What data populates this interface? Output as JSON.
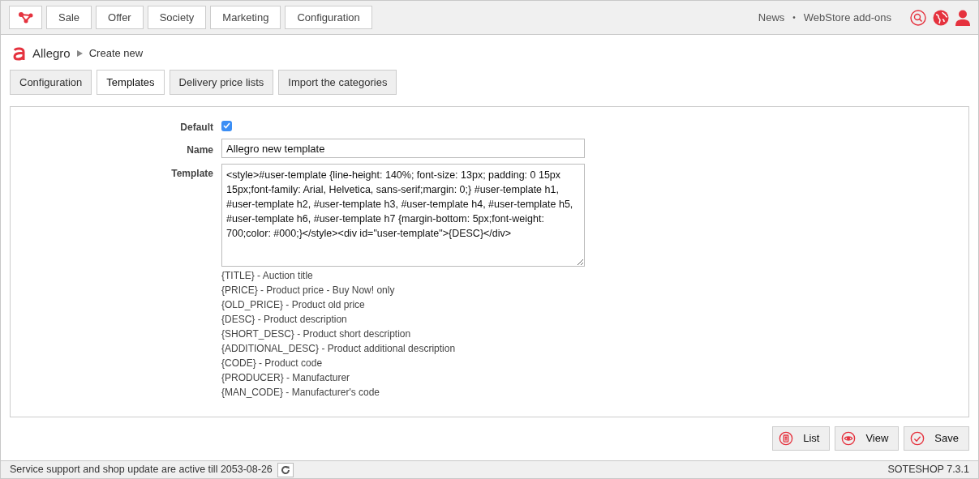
{
  "top_menu": [
    {
      "label": "Sale"
    },
    {
      "label": "Offer"
    },
    {
      "label": "Society"
    },
    {
      "label": "Marketing"
    },
    {
      "label": "Configuration"
    }
  ],
  "top_links": [
    "News",
    "•",
    "WebStore add-ons"
  ],
  "breadcrumb": {
    "title": "Allegro",
    "current": "Create new"
  },
  "tabs": [
    {
      "label": "Configuration",
      "selected": false
    },
    {
      "label": "Templates",
      "selected": true
    },
    {
      "label": "Delivery price lists",
      "selected": false
    },
    {
      "label": "Import the categories",
      "selected": false
    }
  ],
  "form": {
    "default": {
      "label": "Default",
      "checked": true
    },
    "name": {
      "label": "Name",
      "value": "Allegro new template"
    },
    "template": {
      "label": "Template",
      "value": "<style>#user-template {line-height: 140%; font-size: 13px; padding: 0 15px 15px;font-family: Arial, Helvetica, sans-serif;margin: 0;} #user-template h1, #user-template h2, #user-template h3, #user-template h4, #user-template h5, #user-template h6, #user-template h7 {margin-bottom: 5px;font-weight: 700;color: #000;}</style><div id=\"user-template\">{DESC}</div>"
    },
    "placeholders_help": [
      "{TITLE} - Auction title",
      "{PRICE} - Product price - Buy Now! only",
      "{OLD_PRICE} - Product old price",
      "{DESC} - Product description",
      "{SHORT_DESC} - Product short description",
      "{ADDITIONAL_DESC} - Product additional description",
      "{CODE} - Product code",
      "{PRODUCER} - Manufacturer",
      "{MAN_CODE} - Manufacturer's code"
    ]
  },
  "actions": [
    {
      "label": "List",
      "kind": "list"
    },
    {
      "label": "View",
      "kind": "view"
    },
    {
      "label": "Save",
      "kind": "save"
    }
  ],
  "status_bar": {
    "message": "Service support and shop update are active till 2053-08-26",
    "version": "SOTESHOP 7.3.1"
  }
}
